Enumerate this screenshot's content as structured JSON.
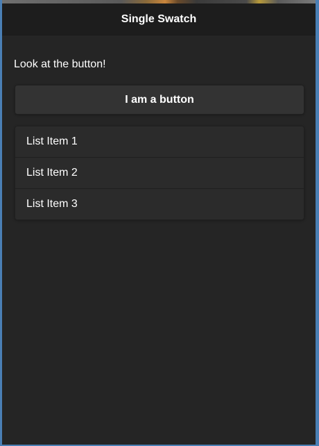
{
  "header": {
    "title": "Single Swatch"
  },
  "main": {
    "intro_text": "Look at the button!",
    "button_label": "I am a button",
    "list": {
      "items": [
        {
          "label": "List Item 1"
        },
        {
          "label": "List Item 2"
        },
        {
          "label": "List Item 3"
        }
      ]
    }
  },
  "colors": {
    "page_background": "#252525",
    "header_background": "#1d1d1d",
    "button_background": "#333333",
    "list_background": "#2b2b2b",
    "text": "#ffffff",
    "outer_frame": "#4a7fb5"
  }
}
